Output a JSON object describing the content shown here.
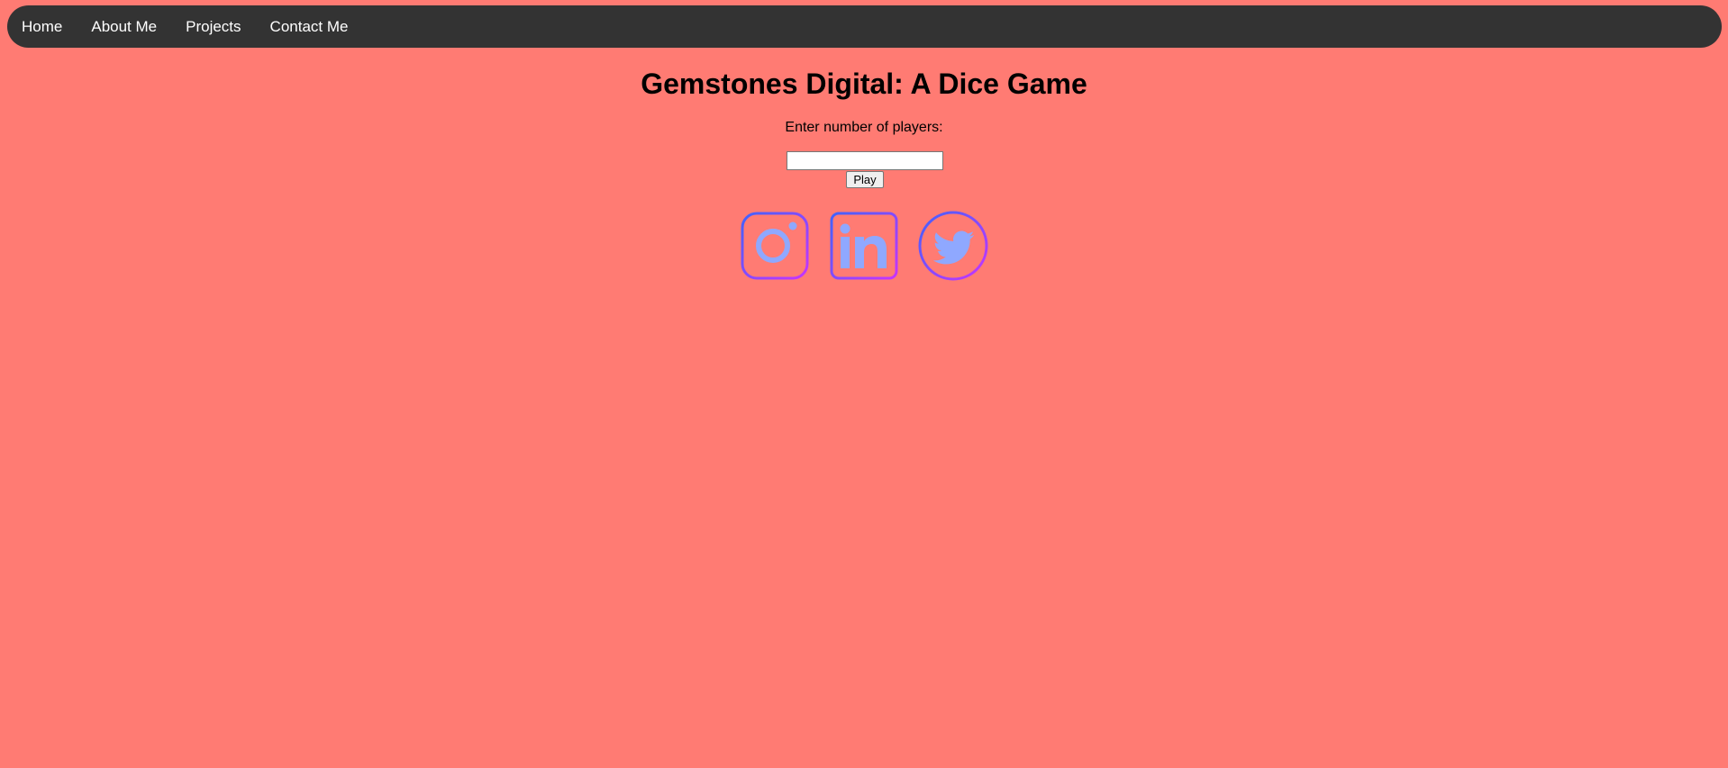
{
  "nav": {
    "items": [
      {
        "label": "Home"
      },
      {
        "label": "About Me"
      },
      {
        "label": "Projects"
      },
      {
        "label": "Contact Me"
      }
    ]
  },
  "main": {
    "title": "Gemstones Digital: A Dice Game",
    "players_prompt": "Enter number of players:",
    "players_input": {
      "value": "",
      "placeholder": ""
    },
    "play_label": "Play"
  },
  "social": {
    "icons": [
      "instagram-icon",
      "linkedin-icon",
      "twitter-icon"
    ]
  },
  "colors": {
    "page_background": "#ff7b73",
    "navbar_background": "#333333",
    "nav_text": "#ffffff",
    "icon_gradient_start": "#3f63ff",
    "icon_gradient_end": "#c933ff",
    "icon_fill": "#8fa8ff"
  }
}
